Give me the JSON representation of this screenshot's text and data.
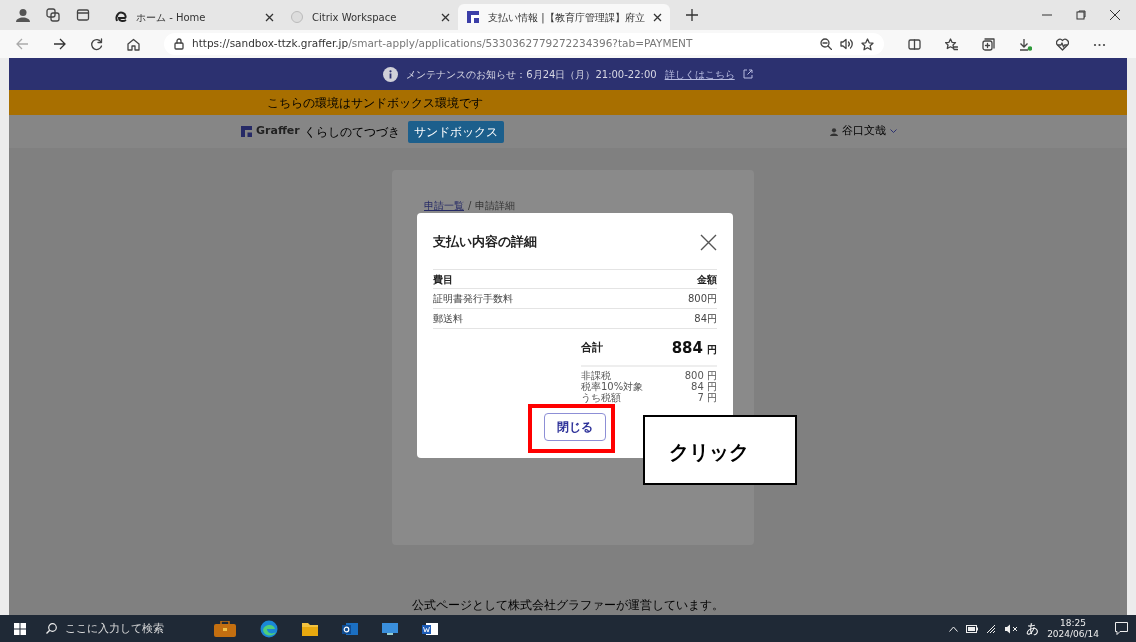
{
  "browser": {
    "tabs": [
      {
        "label": "ホーム - Home",
        "selected": false
      },
      {
        "label": "Citrix Workspace",
        "selected": false
      },
      {
        "label": "支払い情報 |【教育庁管理課】府立",
        "selected": true
      }
    ],
    "url": {
      "host": "https://sandbox-ttzk.graffer.jp",
      "path": "/smart-apply/applications/5330362779272234396?tab=PAYMENT"
    }
  },
  "notice": {
    "text": "メンテナンスのお知らせ：6月24日（月）21:00-22:00",
    "link": "詳しくはこちら"
  },
  "sandbox_bar": "こちらの環境はサンドボックス環境です",
  "header": {
    "logo": "Graffer",
    "tagline": "くらしのてつづき",
    "badge": "サンドボックス",
    "user": "谷口文哉"
  },
  "breadcrumb": [
    {
      "label": "申請一覧",
      "link": true
    },
    {
      "label": "申請詳細",
      "link": false
    }
  ],
  "breadcrumb_separator": "/",
  "modal": {
    "title": "支払い内容の詳細",
    "columns": [
      "費目",
      "金額"
    ],
    "rows": [
      {
        "item": "証明書発行手数料",
        "amount": "800円"
      },
      {
        "item": "郵送料",
        "amount": "84円"
      }
    ],
    "total": {
      "label": "合計",
      "value": "884",
      "unit": "円"
    },
    "breakdown": [
      {
        "label": "非課税",
        "value": "800 円"
      },
      {
        "label": "税率10%対象",
        "value": "84 円"
      },
      {
        "label": "うち税額",
        "value": "7 円"
      }
    ],
    "close_button": "閉じる"
  },
  "annotation": "クリック",
  "footer": "公式ページとして株式会社グラファーが運営しています。",
  "taskbar": {
    "search_placeholder": "ここに入力して検索",
    "ime": "あ",
    "time": "18:25",
    "date": "2024/06/14"
  }
}
